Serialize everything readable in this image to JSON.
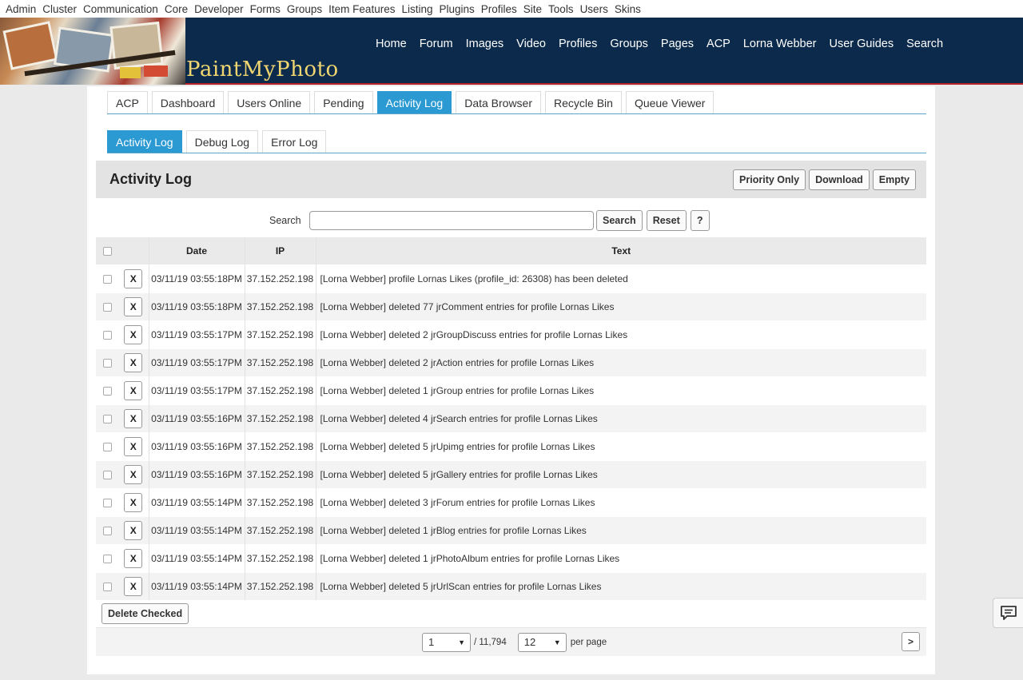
{
  "adminbar": [
    "Admin",
    "Cluster",
    "Communication",
    "Core",
    "Developer",
    "Forms",
    "Groups",
    "Item Features",
    "Listing",
    "Plugins",
    "Profiles",
    "Site",
    "Tools",
    "Users",
    "Skins"
  ],
  "header": {
    "logo_text": "PaintMyPhoto",
    "nav": [
      "Home",
      "Forum",
      "Images",
      "Video",
      "Profiles",
      "Groups",
      "Pages",
      "ACP",
      "Lorna Webber",
      "User Guides",
      "Search"
    ]
  },
  "tabs": [
    "ACP",
    "Dashboard",
    "Users Online",
    "Pending",
    "Activity Log",
    "Data Browser",
    "Recycle Bin",
    "Queue Viewer"
  ],
  "active_tab": "Activity Log",
  "subtabs": [
    "Activity Log",
    "Debug Log",
    "Error Log"
  ],
  "page": {
    "title": "Activity Log",
    "buttons": {
      "priority": "Priority Only",
      "download": "Download",
      "empty": "Empty"
    }
  },
  "search": {
    "label": "Search",
    "value": "",
    "search_btn": "Search",
    "reset_btn": "Reset",
    "help_btn": "?"
  },
  "table": {
    "headers": {
      "date": "Date",
      "ip": "IP",
      "text": "Text"
    },
    "delete_label": "X",
    "rows": [
      {
        "date": "03/11/19 03:55:18PM",
        "ip": "37.152.252.198",
        "text": "[Lorna Webber] profile Lornas Likes (profile_id: 26308) has been deleted"
      },
      {
        "date": "03/11/19 03:55:18PM",
        "ip": "37.152.252.198",
        "text": "[Lorna Webber] deleted 77 jrComment entries for profile Lornas Likes"
      },
      {
        "date": "03/11/19 03:55:17PM",
        "ip": "37.152.252.198",
        "text": "[Lorna Webber] deleted 2 jrGroupDiscuss entries for profile Lornas Likes"
      },
      {
        "date": "03/11/19 03:55:17PM",
        "ip": "37.152.252.198",
        "text": "[Lorna Webber] deleted 2 jrAction entries for profile Lornas Likes"
      },
      {
        "date": "03/11/19 03:55:17PM",
        "ip": "37.152.252.198",
        "text": "[Lorna Webber] deleted 1 jrGroup entries for profile Lornas Likes"
      },
      {
        "date": "03/11/19 03:55:16PM",
        "ip": "37.152.252.198",
        "text": "[Lorna Webber] deleted 4 jrSearch entries for profile Lornas Likes"
      },
      {
        "date": "03/11/19 03:55:16PM",
        "ip": "37.152.252.198",
        "text": "[Lorna Webber] deleted 5 jrUpimg entries for profile Lornas Likes"
      },
      {
        "date": "03/11/19 03:55:16PM",
        "ip": "37.152.252.198",
        "text": "[Lorna Webber] deleted 5 jrGallery entries for profile Lornas Likes"
      },
      {
        "date": "03/11/19 03:55:14PM",
        "ip": "37.152.252.198",
        "text": "[Lorna Webber] deleted 3 jrForum entries for profile Lornas Likes"
      },
      {
        "date": "03/11/19 03:55:14PM",
        "ip": "37.152.252.198",
        "text": "[Lorna Webber] deleted 1 jrBlog entries for profile Lornas Likes"
      },
      {
        "date": "03/11/19 03:55:14PM",
        "ip": "37.152.252.198",
        "text": "[Lorna Webber] deleted 1 jrPhotoAlbum entries for profile Lornas Likes"
      },
      {
        "date": "03/11/19 03:55:14PM",
        "ip": "37.152.252.198",
        "text": "[Lorna Webber] deleted 5 jrUrlScan entries for profile Lornas Likes"
      }
    ]
  },
  "footer": {
    "delete_checked": "Delete Checked",
    "page_value": "1",
    "page_total": "/ 11,794",
    "per_page_value": "12",
    "per_page_label": "per page",
    "next": ">"
  },
  "colors": {
    "header_bg": "#0c2b4c",
    "accent": "#2b9ad3",
    "logo_text": "#f0d570"
  },
  "icons": {
    "chat": "chat-bubble-icon",
    "select_arrow": "chevron-down-icon"
  }
}
